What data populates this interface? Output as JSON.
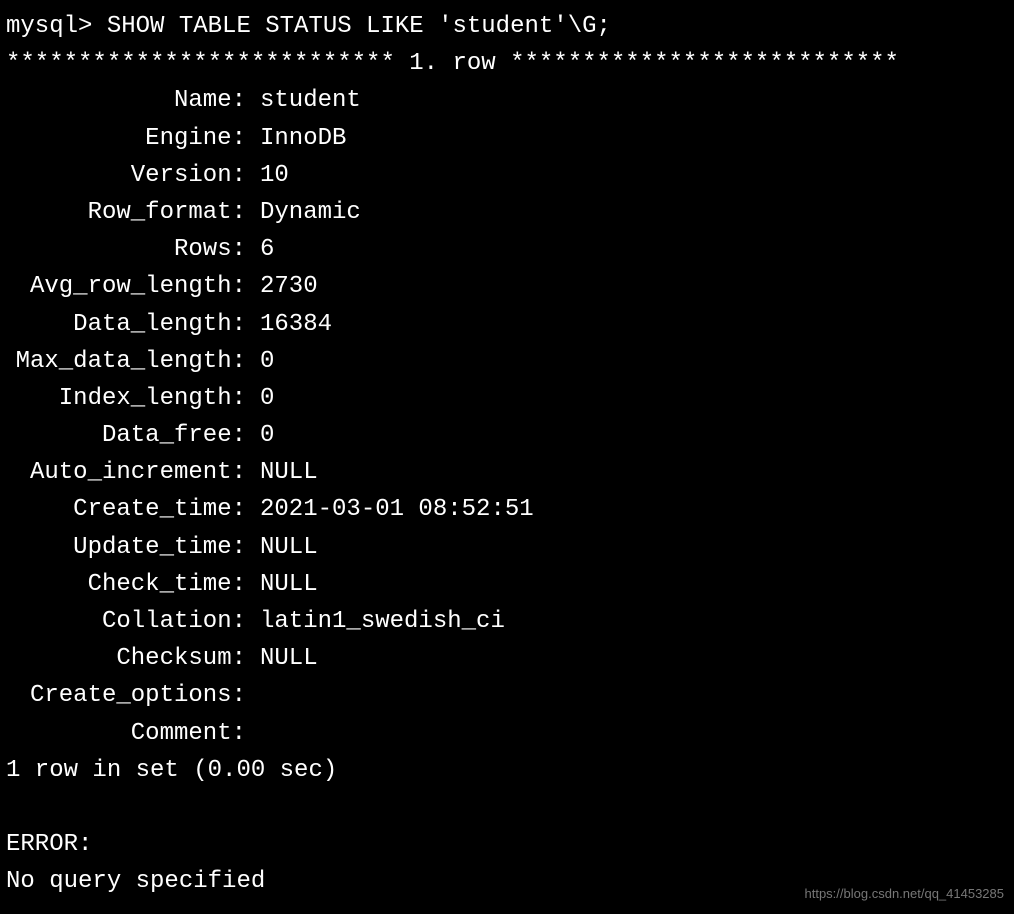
{
  "prompt": "mysql> SHOW TABLE STATUS LIKE 'student'\\G;",
  "row_header": "*************************** 1. row ***************************",
  "fields": [
    {
      "label": "Name:",
      "value": "student"
    },
    {
      "label": "Engine:",
      "value": "InnoDB"
    },
    {
      "label": "Version:",
      "value": "10"
    },
    {
      "label": "Row_format:",
      "value": "Dynamic"
    },
    {
      "label": "Rows:",
      "value": "6"
    },
    {
      "label": "Avg_row_length:",
      "value": "2730"
    },
    {
      "label": "Data_length:",
      "value": "16384"
    },
    {
      "label": "Max_data_length:",
      "value": "0"
    },
    {
      "label": "Index_length:",
      "value": "0"
    },
    {
      "label": "Data_free:",
      "value": "0"
    },
    {
      "label": "Auto_increment:",
      "value": "NULL"
    },
    {
      "label": "Create_time:",
      "value": "2021-03-01 08:52:51"
    },
    {
      "label": "Update_time:",
      "value": "NULL"
    },
    {
      "label": "Check_time:",
      "value": "NULL"
    },
    {
      "label": "Collation:",
      "value": "latin1_swedish_ci"
    },
    {
      "label": "Checksum:",
      "value": "NULL"
    },
    {
      "label": "Create_options:",
      "value": ""
    },
    {
      "label": "Comment:",
      "value": ""
    }
  ],
  "summary": "1 row in set (0.00 sec)",
  "error_label": "ERROR:",
  "error_message": "No query specified",
  "watermark": "https://blog.csdn.net/qq_41453285"
}
